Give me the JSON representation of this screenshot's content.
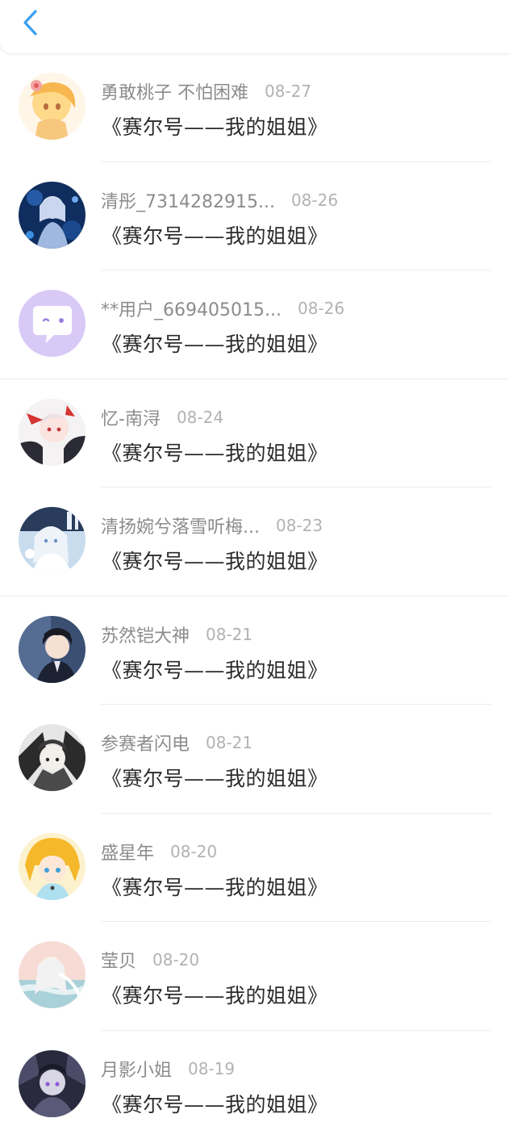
{
  "header": {
    "back_icon": "chevron-left-icon",
    "accent": "#3a9ef0"
  },
  "rows": [
    {
      "name": "勇敢桃子 不怕困难",
      "date": "08-27",
      "title": "《赛尔号——我的姐姐》"
    },
    {
      "name": "清彤_7314282915...",
      "date": "08-26",
      "title": "《赛尔号——我的姐姐》"
    },
    {
      "name": "**用户_669405015...",
      "date": "08-26",
      "title": "《赛尔号——我的姐姐》"
    },
    {
      "name": "忆-南浔",
      "date": "08-24",
      "title": "《赛尔号——我的姐姐》"
    },
    {
      "name": "清扬婉兮落雪听梅...",
      "date": "08-23",
      "title": "《赛尔号——我的姐姐》"
    },
    {
      "name": "苏然铠大神",
      "date": "08-21",
      "title": "《赛尔号——我的姐姐》"
    },
    {
      "name": "参赛者闪电",
      "date": "08-21",
      "title": "《赛尔号——我的姐姐》"
    },
    {
      "name": "盛星年",
      "date": "08-20",
      "title": "《赛尔号——我的姐姐》"
    },
    {
      "name": "莹贝",
      "date": "08-20",
      "title": "《赛尔号——我的姐姐》"
    },
    {
      "name": "月影小姐",
      "date": "08-19",
      "title": "《赛尔号——我的姐姐》"
    }
  ]
}
